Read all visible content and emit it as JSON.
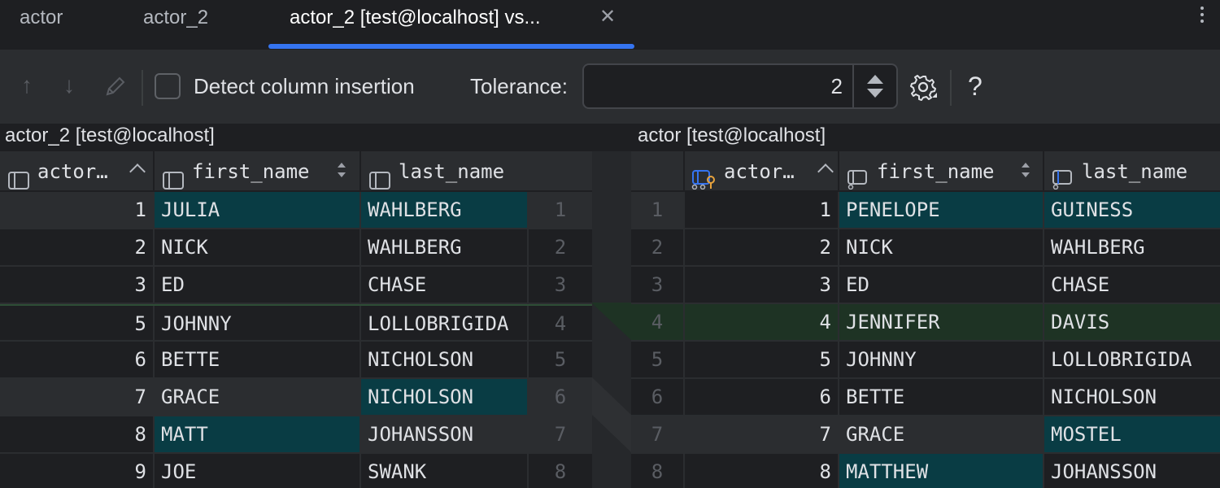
{
  "tabs": [
    {
      "label": "actor"
    },
    {
      "label": "actor_2"
    },
    {
      "label": "actor_2 [test@localhost] vs..."
    }
  ],
  "toolbar": {
    "up_arrow": "↑",
    "down_arrow": "↓",
    "edit_icon": "edit-icon",
    "detect_label": "Detect column insertion",
    "detect_checked": false,
    "tolerance_label": "Tolerance:",
    "tolerance_value": "2",
    "help": "?"
  },
  "left": {
    "title": "actor_2 [test@localhost]",
    "columns": [
      "actor…",
      "first_name",
      "last_name"
    ],
    "rows": [
      {
        "id": "1",
        "first": "JULIA",
        "last": "WAHLBERG",
        "gutter": "1"
      },
      {
        "id": "2",
        "first": "NICK",
        "last": "WAHLBERG",
        "gutter": "2"
      },
      {
        "id": "3",
        "first": "ED",
        "last": "CHASE",
        "gutter": "3"
      },
      {
        "id": "5",
        "first": "JOHNNY",
        "last": "LOLLOBRIGIDA",
        "gutter": "4"
      },
      {
        "id": "6",
        "first": "BETTE",
        "last": "NICHOLSON",
        "gutter": "5"
      },
      {
        "id": "7",
        "first": "GRACE",
        "last": "NICHOLSON",
        "gutter": "6"
      },
      {
        "id": "8",
        "first": "MATT",
        "last": "JOHANSSON",
        "gutter": "7"
      },
      {
        "id": "9",
        "first": "JOE",
        "last": "SWANK",
        "gutter": "8"
      }
    ]
  },
  "right": {
    "title": "actor [test@localhost]",
    "columns": [
      "actor…",
      "first_name",
      "last_name"
    ],
    "rows": [
      {
        "gutter": "1",
        "id": "1",
        "first": "PENELOPE",
        "last": "GUINESS"
      },
      {
        "gutter": "2",
        "id": "2",
        "first": "NICK",
        "last": "WAHLBERG"
      },
      {
        "gutter": "3",
        "id": "3",
        "first": "ED",
        "last": "CHASE"
      },
      {
        "gutter": "4",
        "id": "4",
        "first": "JENNIFER",
        "last": "DAVIS"
      },
      {
        "gutter": "5",
        "id": "5",
        "first": "JOHNNY",
        "last": "LOLLOBRIGIDA"
      },
      {
        "gutter": "6",
        "id": "6",
        "first": "BETTE",
        "last": "NICHOLSON"
      },
      {
        "gutter": "7",
        "id": "7",
        "first": "GRACE",
        "last": "MOSTEL"
      },
      {
        "gutter": "8",
        "id": "8",
        "first": "MATTHEW",
        "last": "JOHANSSON"
      }
    ]
  },
  "colors": {
    "accent": "#3574f0",
    "changed_cell": "#093c44",
    "inserted_row": "#1e3324",
    "key_icon": "#e8a33d"
  },
  "icons": {
    "close": "close-icon",
    "more": "more-vertical-icon",
    "settings": "gear-icon",
    "column": "column-icon",
    "key_column": "key-column-icon"
  }
}
